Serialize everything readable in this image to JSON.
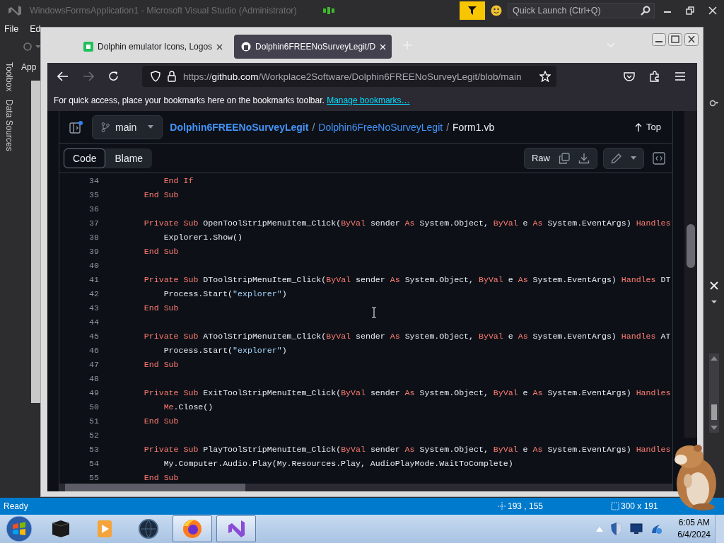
{
  "vs_window": {
    "title": "WindowsFormsApplication1 - Microsoft Visual Studio (Administrator)",
    "quick_launch": {
      "placeholder": "Quick Launch (Ctrl+Q)"
    },
    "menu": [
      "File",
      "Ed"
    ],
    "side_tabs": [
      "Toolbox",
      "Data Sources"
    ],
    "document_tab": "App",
    "status_bar": {
      "text": "Ready",
      "cursor_position": "193 , 155",
      "selection_size": "300 x 191"
    }
  },
  "browser": {
    "tabs": [
      {
        "title": "Dolphin emulator Icons, Logos",
        "kind": "favicon",
        "selected": false
      },
      {
        "title": "Dolphin6FREENoSurveyLegit/D",
        "kind": "github",
        "selected": true
      }
    ],
    "forward_disabled": true,
    "url": [
      {
        "text": "https://",
        "kind": "dim"
      },
      {
        "text": "github.com",
        "kind": "host"
      },
      {
        "text": "/Workplace2Software/Dolphin6FREENoSurveyLegit/blob/main",
        "kind": "dim"
      }
    ],
    "bookmarks_bar": {
      "message": "For quick access, place your bookmarks here on the bookmarks toolbar.",
      "link": "Manage bookmarks…"
    }
  },
  "file_view": {
    "branch": "main",
    "breadcrumb": [
      {
        "text": "Dolphin6FREENoSurveyLegit",
        "kind": "link"
      },
      {
        "text": "/",
        "kind": "separator"
      },
      {
        "text": "Dolphin6FreeNoSurveyLegit",
        "kind": "link"
      },
      {
        "text": "/",
        "kind": "separator"
      },
      {
        "text": "Form1.vb",
        "kind": "current"
      }
    ],
    "top_link": "Top",
    "view_tabs": [
      {
        "label": "Code",
        "selected": true
      },
      {
        "label": "Blame",
        "selected": false
      }
    ],
    "raw_button": "Raw",
    "lines": [
      {
        "number": "34",
        "tokens": [
          {
            "kind": "keyword",
            "text": "        End If"
          }
        ]
      },
      {
        "number": "35",
        "tokens": [
          {
            "kind": "keyword",
            "text": "    End Sub"
          }
        ]
      },
      {
        "number": "36"
      },
      {
        "number": "37",
        "tokens": [
          {
            "kind": "keyword",
            "text": "    Private Sub"
          },
          {
            "kind": "plain",
            "text": " OpenToolStripMenuItem_Click("
          },
          {
            "kind": "keyword",
            "text": "ByVal"
          },
          {
            "kind": "plain",
            "text": " sender "
          },
          {
            "kind": "keyword",
            "text": "As"
          },
          {
            "kind": "plain",
            "text": " System.Object, "
          },
          {
            "kind": "keyword",
            "text": "ByVal"
          },
          {
            "kind": "plain",
            "text": " e "
          },
          {
            "kind": "keyword",
            "text": "As"
          },
          {
            "kind": "plain",
            "text": " System.EventArgs) "
          },
          {
            "kind": "keyword",
            "text": "Handles"
          }
        ]
      },
      {
        "number": "38",
        "tokens": [
          {
            "kind": "plain",
            "text": "        Explorer1.Show()"
          }
        ]
      },
      {
        "number": "39",
        "tokens": [
          {
            "kind": "keyword",
            "text": "    End Sub"
          }
        ]
      },
      {
        "number": "40"
      },
      {
        "number": "41",
        "tokens": [
          {
            "kind": "keyword",
            "text": "    Private Sub"
          },
          {
            "kind": "plain",
            "text": " DToolStripMenuItem_Click("
          },
          {
            "kind": "keyword",
            "text": "ByVal"
          },
          {
            "kind": "plain",
            "text": " sender "
          },
          {
            "kind": "keyword",
            "text": "As"
          },
          {
            "kind": "plain",
            "text": " System.Object, "
          },
          {
            "kind": "keyword",
            "text": "ByVal"
          },
          {
            "kind": "plain",
            "text": " e "
          },
          {
            "kind": "keyword",
            "text": "As"
          },
          {
            "kind": "plain",
            "text": " System.EventArgs) "
          },
          {
            "kind": "keyword",
            "text": "Handles"
          },
          {
            "kind": "plain",
            "text": " DT"
          }
        ]
      },
      {
        "number": "42",
        "tokens": [
          {
            "kind": "plain",
            "text": "        Process.Start("
          },
          {
            "kind": "string",
            "text": "\"explorer\""
          },
          {
            "kind": "plain",
            "text": ")"
          }
        ]
      },
      {
        "number": "43",
        "tokens": [
          {
            "kind": "keyword",
            "text": "    End Sub"
          }
        ]
      },
      {
        "number": "44"
      },
      {
        "number": "45",
        "tokens": [
          {
            "kind": "keyword",
            "text": "    Private Sub"
          },
          {
            "kind": "plain",
            "text": " AToolStripMenuItem_Click("
          },
          {
            "kind": "keyword",
            "text": "ByVal"
          },
          {
            "kind": "plain",
            "text": " sender "
          },
          {
            "kind": "keyword",
            "text": "As"
          },
          {
            "kind": "plain",
            "text": " System.Object, "
          },
          {
            "kind": "keyword",
            "text": "ByVal"
          },
          {
            "kind": "plain",
            "text": " e "
          },
          {
            "kind": "keyword",
            "text": "As"
          },
          {
            "kind": "plain",
            "text": " System.EventArgs) "
          },
          {
            "kind": "keyword",
            "text": "Handles"
          },
          {
            "kind": "plain",
            "text": " AT"
          }
        ]
      },
      {
        "number": "46",
        "tokens": [
          {
            "kind": "plain",
            "text": "        Process.Start("
          },
          {
            "kind": "string",
            "text": "\"explorer\""
          },
          {
            "kind": "plain",
            "text": ")"
          }
        ]
      },
      {
        "number": "47",
        "tokens": [
          {
            "kind": "keyword",
            "text": "    End Sub"
          }
        ]
      },
      {
        "number": "48"
      },
      {
        "number": "49",
        "tokens": [
          {
            "kind": "keyword",
            "text": "    Private Sub"
          },
          {
            "kind": "plain",
            "text": " ExitToolStripMenuItem_Click("
          },
          {
            "kind": "keyword",
            "text": "ByVal"
          },
          {
            "kind": "plain",
            "text": " sender "
          },
          {
            "kind": "keyword",
            "text": "As"
          },
          {
            "kind": "plain",
            "text": " System.Object, "
          },
          {
            "kind": "keyword",
            "text": "ByVal"
          },
          {
            "kind": "plain",
            "text": " e "
          },
          {
            "kind": "keyword",
            "text": "As"
          },
          {
            "kind": "plain",
            "text": " System.EventArgs) "
          },
          {
            "kind": "keyword",
            "text": "Handles"
          }
        ]
      },
      {
        "number": "50",
        "tokens": [
          {
            "kind": "keyword",
            "text": "        Me"
          },
          {
            "kind": "plain",
            "text": ".Close()"
          }
        ]
      },
      {
        "number": "51",
        "tokens": [
          {
            "kind": "keyword",
            "text": "    End Sub"
          }
        ]
      },
      {
        "number": "52"
      },
      {
        "number": "53",
        "tokens": [
          {
            "kind": "keyword",
            "text": "    Private Sub"
          },
          {
            "kind": "plain",
            "text": " PlayToolStripMenuItem_Click("
          },
          {
            "kind": "keyword",
            "text": "ByVal"
          },
          {
            "kind": "plain",
            "text": " sender "
          },
          {
            "kind": "keyword",
            "text": "As"
          },
          {
            "kind": "plain",
            "text": " System.Object, "
          },
          {
            "kind": "keyword",
            "text": "ByVal"
          },
          {
            "kind": "plain",
            "text": " e "
          },
          {
            "kind": "keyword",
            "text": "As"
          },
          {
            "kind": "plain",
            "text": " System.EventArgs) "
          },
          {
            "kind": "keyword",
            "text": "Handles"
          }
        ]
      },
      {
        "number": "54",
        "tokens": [
          {
            "kind": "plain",
            "text": "        My.Computer.Audio.Play(My.Resources.Play, AudioPlayMode.WaitToComplete)"
          }
        ]
      },
      {
        "number": "55",
        "tokens": [
          {
            "kind": "keyword",
            "text": "    End Sub"
          }
        ]
      }
    ]
  },
  "taskbar": {
    "apps": [
      {
        "kind": "box",
        "selected": false
      },
      {
        "kind": "media",
        "selected": false
      },
      {
        "kind": "globe",
        "selected": false
      },
      {
        "kind": "browser",
        "selected": true
      },
      {
        "kind": "ide",
        "selected": true
      }
    ],
    "time": "6:05 AM",
    "date": "6/4/2024"
  }
}
